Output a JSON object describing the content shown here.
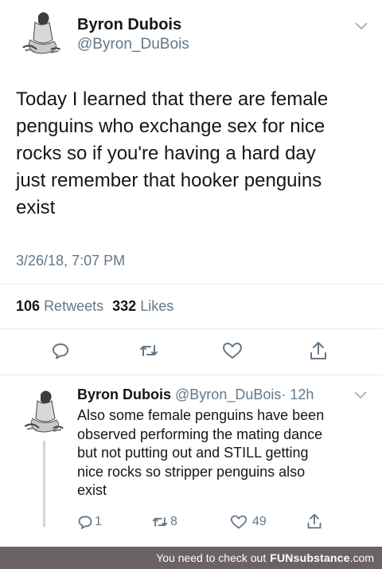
{
  "main_tweet": {
    "author_name": "Byron Dubois",
    "author_handle": "@Byron_DuBois",
    "text_lines": [
      "Today I learned that there are female",
      "penguins who exchange sex for nice",
      "rocks so if you're having a hard day",
      "just remember that hooker penguins",
      "exist"
    ],
    "timestamp": "3/26/18, 7:07 PM",
    "retweets_count": "106",
    "retweets_label": "Retweets",
    "likes_count": "332",
    "likes_label": "Likes",
    "icons": [
      "reply-icon",
      "retweet-icon",
      "like-icon",
      "share-icon",
      "chevron-down-icon"
    ]
  },
  "reply_tweet": {
    "author_name": "Byron Dubois",
    "author_handle": "@Byron_DuBois",
    "time_ago": "· 12h",
    "text_lines": [
      "Also some female penguins have been",
      "observed performing the mating dance",
      "but not putting out and STILL getting",
      "nice rocks so stripper penguins also",
      "exist"
    ],
    "reply_count": "1",
    "retweet_count": "8",
    "like_count": "49"
  },
  "watermark": {
    "text": "You need to check out",
    "brand": "FUNsubstance",
    "domain": ".com"
  },
  "colors": {
    "text": "#14171a",
    "muted": "#657786",
    "divider": "#e6ecf0",
    "footer_bg": "#6b6363"
  }
}
